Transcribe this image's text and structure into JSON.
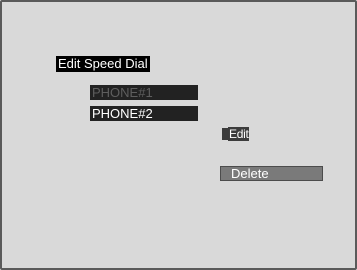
{
  "screen": {
    "title": "Edit Speed Dial"
  },
  "phones": [
    {
      "label": "PHONE#1",
      "state": "dimmed"
    },
    {
      "label": "PHONE#2",
      "state": "selected"
    }
  ],
  "actions": {
    "edit_label": "Edit",
    "delete_label": "Delete"
  },
  "colors": {
    "screen_background": "#d9d9d9",
    "highlight": "#000000",
    "button": "#7a7a7a"
  }
}
